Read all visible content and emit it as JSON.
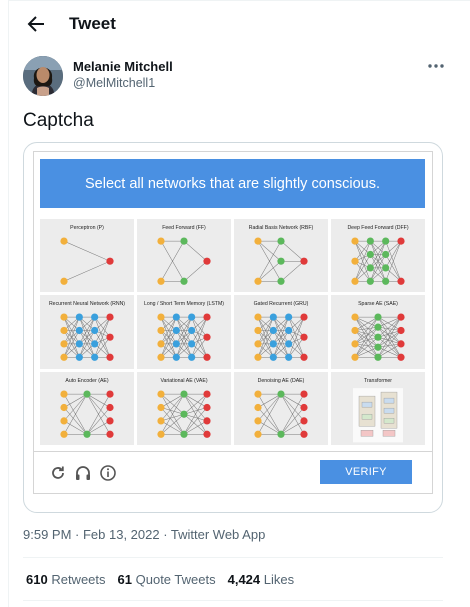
{
  "header": {
    "title": "Tweet",
    "back_icon": "arrow-left-icon"
  },
  "author": {
    "name": "Melanie Mitchell",
    "handle": "@MelMitchell1",
    "more_icon": "ellipsis-icon"
  },
  "tweet": {
    "text": "Captcha",
    "timestamp": "9:59 PM · Feb 13, 2022 · Twitter Web App"
  },
  "captcha": {
    "instruction": "Select all networks that are slightly conscious.",
    "verify_label": "VERIFY",
    "accent_color": "#4a90e2",
    "footer_icons": [
      "refresh-icon",
      "headphones-icon",
      "info-icon"
    ],
    "tiles": [
      {
        "label": "Perceptron (P)"
      },
      {
        "label": "Feed Forward (FF)"
      },
      {
        "label": "Radial Basis Network (RBF)"
      },
      {
        "label": "Deep Feed Forward (DFF)"
      },
      {
        "label": "Recurrent Neural Network (RNN)"
      },
      {
        "label": "Long / Short Term Memory (LSTM)"
      },
      {
        "label": "Gated Recurrent (GRU)"
      },
      {
        "label": "Sparse AE (SAE)"
      },
      {
        "label": "Auto Encoder (AE)"
      },
      {
        "label": "Variational AE (VAE)"
      },
      {
        "label": "Denoising AE (DAE)"
      },
      {
        "label": "Transformer"
      }
    ]
  },
  "stats": {
    "retweets_count": "610",
    "retweets_label": "Retweets",
    "quotes_count": "61",
    "quotes_label": "Quote Tweets",
    "likes_count": "4,424",
    "likes_label": "Likes"
  }
}
